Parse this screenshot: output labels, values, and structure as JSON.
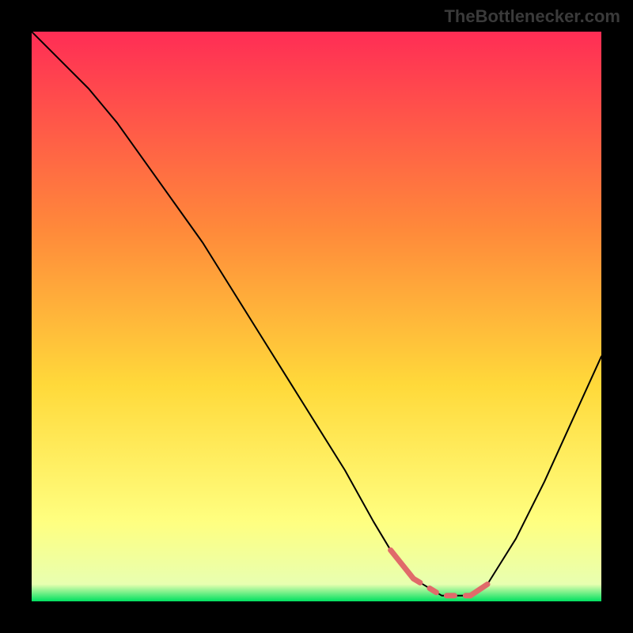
{
  "watermark": "TheBottlenecker.com",
  "chart_data": {
    "type": "line",
    "title": "",
    "xlabel": "",
    "ylabel": "",
    "xlim": [
      0,
      100
    ],
    "ylim": [
      0,
      100
    ],
    "grid": false,
    "background_gradient": {
      "top": "#ff2d55",
      "mid1": "#ff6a3c",
      "mid2": "#ffd93a",
      "mid3": "#ffff66",
      "bottom": "#00e060"
    },
    "series": [
      {
        "name": "bottleneck-curve",
        "x": [
          0,
          3,
          6,
          10,
          15,
          20,
          25,
          30,
          35,
          40,
          45,
          50,
          55,
          60,
          63,
          67,
          72,
          77,
          80,
          85,
          90,
          95,
          100
        ],
        "y": [
          100,
          97,
          94,
          90,
          84,
          77,
          70,
          63,
          55,
          47,
          39,
          31,
          23,
          14,
          9,
          4,
          1,
          1,
          3,
          11,
          21,
          32,
          43
        ],
        "stroke": "#000000",
        "stroke_width": 2
      },
      {
        "name": "marked-segment-left",
        "x": [
          63,
          67
        ],
        "y": [
          9,
          4
        ],
        "stroke": "#e06a6a",
        "stroke_width": 7
      },
      {
        "name": "marked-segment-bottom",
        "x": [
          67,
          72,
          77
        ],
        "y": [
          4,
          1,
          1
        ],
        "stroke": "#e06a6a",
        "stroke_width": 7,
        "dashed": true
      },
      {
        "name": "marked-segment-right",
        "x": [
          77,
          80
        ],
        "y": [
          1,
          3
        ],
        "stroke": "#e06a6a",
        "stroke_width": 7
      }
    ]
  }
}
